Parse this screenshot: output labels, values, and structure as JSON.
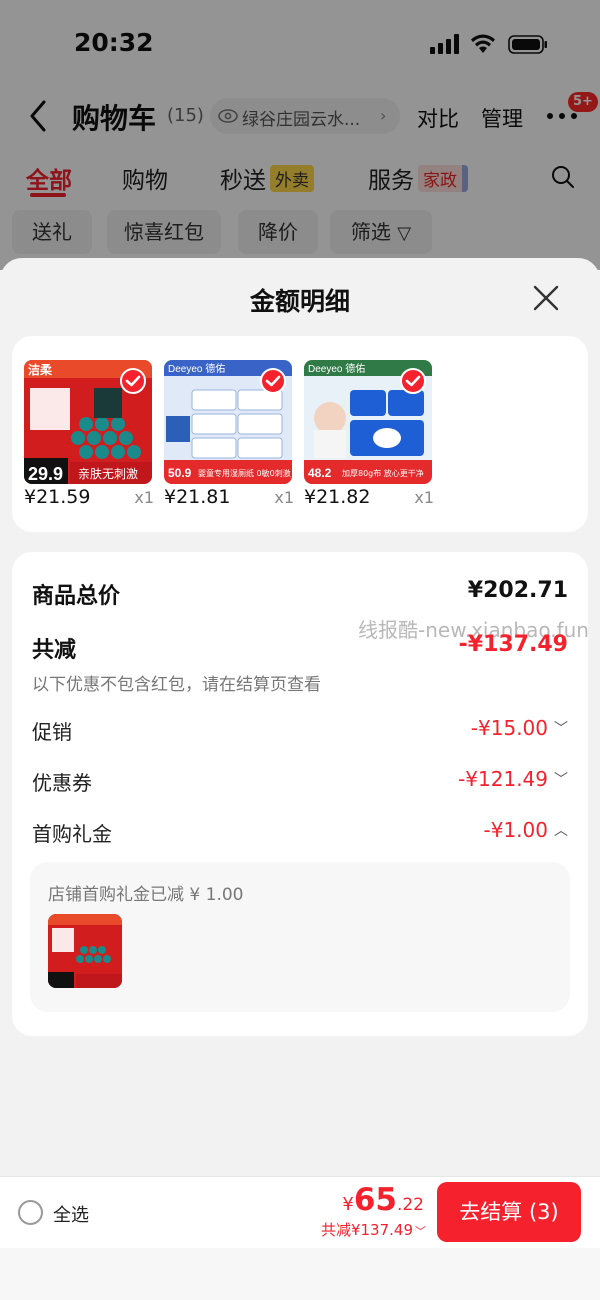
{
  "status": {
    "time": "20:32"
  },
  "nav": {
    "title": "购物车",
    "count": "(15)",
    "address": "绿谷庄园云水...",
    "compare": "对比",
    "manage": "管理",
    "badge": "5+"
  },
  "tabs": [
    {
      "label": "全部",
      "active": true
    },
    {
      "label": "购物"
    },
    {
      "label": "秒送",
      "tag": "外卖"
    },
    {
      "label": "服务",
      "tag": "家政"
    }
  ],
  "filters": [
    "送礼",
    "惊喜红包",
    "降价",
    "筛选"
  ],
  "sheet": {
    "title": "金额明细",
    "goods": [
      {
        "price": "¥21.59",
        "qty": "x1",
        "brand": "洁柔",
        "promo": "亲肤无刺激",
        "price_badge": "29.9"
      },
      {
        "price": "¥21.81",
        "qty": "x1",
        "brand": "Deeyeo 德佑",
        "promo": "婴童专用湿厕纸 0敏0刺激",
        "price_badge": "50.9"
      },
      {
        "price": "¥21.82",
        "qty": "x1",
        "brand": "Deeyeo 德佑",
        "promo": "加厚80g布 放心更干净",
        "price_badge": "48.2"
      }
    ],
    "detail": {
      "total_label": "商品总价",
      "total_value": "¥202.71",
      "reduce_label": "共减",
      "reduce_value": "-¥137.49",
      "note": "以下优惠不包含红包，请在结算页查看",
      "promo_label": "促销",
      "promo_value": "-¥15.00",
      "coupon_label": "优惠券",
      "coupon_value": "-¥121.49",
      "gift_label": "首购礼金",
      "gift_value": "-¥1.00",
      "gift_note": "店铺首购礼金已减 ¥ 1.00"
    },
    "watermark": "线报酷-new.xianbao.fun"
  },
  "bottom": {
    "select_all": "全选",
    "price_symbol": "¥",
    "price_int": "65",
    "price_dec": ".22",
    "reduce_text": "共减¥137.49",
    "checkout": "去结算 (3)"
  },
  "colors": {
    "accent": "#f5222d",
    "sheet_bg": "#f2f2f2"
  }
}
